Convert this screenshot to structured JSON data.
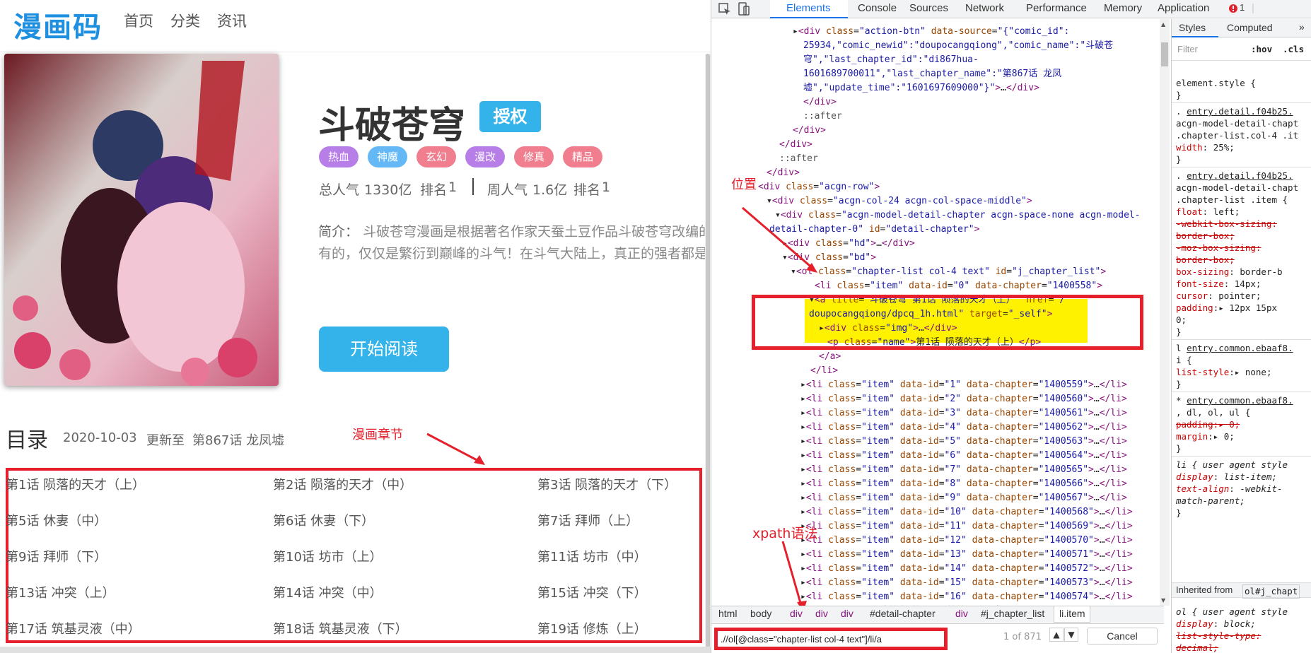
{
  "site": {
    "logo": "漫画码",
    "nav": [
      "首页",
      "分类",
      "资讯"
    ],
    "comic": {
      "title": "斗破苍穹",
      "badge": "授权",
      "tags": [
        {
          "label": "热血",
          "color": "#b77ee8"
        },
        {
          "label": "神魔",
          "color": "#63b8f5"
        },
        {
          "label": "玄幻",
          "color": "#f07e8e"
        },
        {
          "label": "漫改",
          "color": "#b77ee8"
        },
        {
          "label": "修真",
          "color": "#f07e8e"
        },
        {
          "label": "精品",
          "color": "#f07e8e"
        }
      ],
      "stats": {
        "total_label": "总人气",
        "total": "1330亿",
        "rank_label": "排名",
        "rank": "1",
        "weekly_label": "周人气",
        "weekly": "1.6亿",
        "rank2_label": "排名",
        "rank2": "1"
      },
      "intro_label": "简介：",
      "intro_line1": "斗破苍穹漫画是根据著名作家天蚕土豆作品斗破苍穹改编的",
      "intro_line2": "有的，仅仅是繁衍到巅峰的斗气！在斗气大陆上，真正的强者都是",
      "read_button": "开始阅读"
    },
    "toc": {
      "title": "目录",
      "date": "2020-10-03",
      "updated_label": "更新至",
      "latest": "第867话 龙凤墟",
      "annotation": "漫画章节",
      "chapters": [
        [
          "第1话 陨落的天才（上）",
          "第2话 陨落的天才（中）",
          "第3话 陨落的天才（下）"
        ],
        [
          "第5话 休妻（中）",
          "第6话 休妻（下）",
          "第7话 拜师（上）"
        ],
        [
          "第9话 拜师（下）",
          "第10话 坊市（上）",
          "第11话 坊市（中）"
        ],
        [
          "第13话 冲突（上）",
          "第14话 冲突（中）",
          "第15话 冲突（下）"
        ],
        [
          "第17话 筑基灵液（中）",
          "第18话 筑基灵液（下）",
          "第19话 修炼（上）"
        ]
      ]
    }
  },
  "devtools": {
    "tabs": [
      "Elements",
      "Console",
      "Sources",
      "Network",
      "Performance",
      "Memory",
      "Application"
    ],
    "error_count": "1",
    "annotations": {
      "position": "位置",
      "xpath": "xpath语法"
    },
    "breadcrumbs": [
      "html",
      "body",
      "div",
      "div",
      "div",
      "#detail-chapter",
      "div",
      "#j_chapter_list",
      "li.item"
    ],
    "search": {
      "value": ".//ol[@class=\"chapter-list col-4 text\"]/li/a",
      "count": "1 of 871",
      "cancel": "Cancel"
    },
    "styles_tabs": [
      "Styles",
      "Computed"
    ],
    "filter_placeholder": "Filter",
    "hov": ":hov",
    "cls": ".cls",
    "inherited_label": "Inherited from",
    "inherited_from": "ol#j_chapt"
  }
}
